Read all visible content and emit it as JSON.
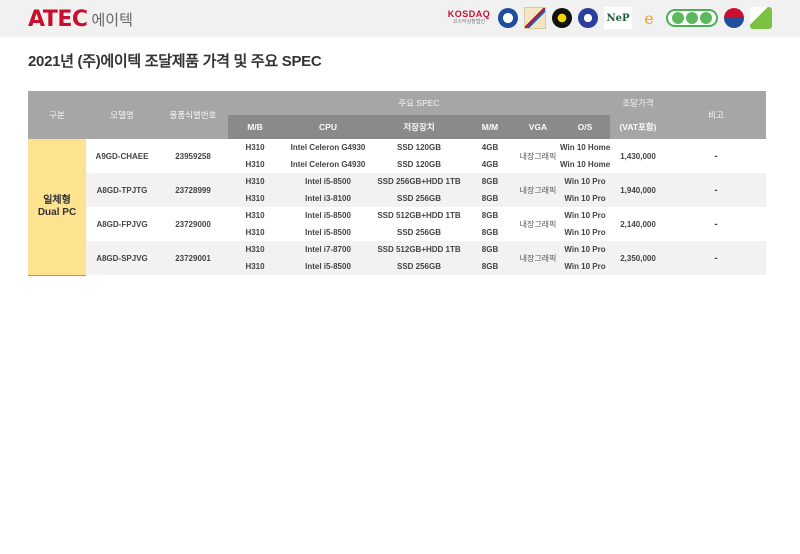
{
  "header": {
    "brand": "ATEC",
    "brand_kr": "에이텍",
    "brand_color": "#c8102e",
    "certifications": [
      {
        "name": "kosdaq-logo",
        "label": "KOSDAQ",
        "sub": "코스닥상장법인"
      },
      {
        "name": "certification-emblem-blue-icon"
      },
      {
        "name": "certification-emblem-flag-icon"
      },
      {
        "name": "good-design-icon",
        "sub": "GOOD DESIGN"
      },
      {
        "name": "e-certification-icon"
      },
      {
        "name": "nep-icon",
        "label": "NeP"
      },
      {
        "name": "e-mark-icon"
      },
      {
        "name": "green-certification-badge-icon"
      },
      {
        "name": "korea-government-icon",
        "sub": "특허청"
      },
      {
        "name": "green-tech-icon",
        "sub": "녹색인증"
      }
    ]
  },
  "page_title": "2021년 (주)에이텍 조달제품 가격 및 주요 SPEC",
  "table": {
    "headers": {
      "category": "구분",
      "model": "모델명",
      "item_id": "물품식별번호",
      "spec_group": "주요 SPEC",
      "mb": "M/B",
      "cpu": "CPU",
      "storage": "저장장치",
      "mm": "M/M",
      "vga": "VGA",
      "os": "O/S",
      "price_line1": "조달가격",
      "price_line2": "(VAT포함)",
      "note": "비고"
    },
    "category_line1": "일체형",
    "category_line2": "Dual PC",
    "category_color": "#fde290",
    "products": [
      {
        "model": "A9GD-CHAEE",
        "item_id": "23959258",
        "vga": "내장그래픽",
        "price": "1,430,000",
        "note": "-",
        "configs": [
          {
            "mb": "H310",
            "cpu": "Intel Celeron G4930",
            "storage": "SSD 120GB",
            "mm": "4GB",
            "os": "Win 10 Home"
          },
          {
            "mb": "H310",
            "cpu": "Intel Celeron G4930",
            "storage": "SSD 120GB",
            "mm": "4GB",
            "os": "Win 10 Home"
          }
        ]
      },
      {
        "model": "A8GD-TPJTG",
        "item_id": "23728999",
        "vga": "내장그래픽",
        "price": "1,940,000",
        "note": "-",
        "configs": [
          {
            "mb": "H310",
            "cpu": "Intel i5-8500",
            "storage": "SSD 256GB+HDD 1TB",
            "mm": "8GB",
            "os": "Win 10 Pro"
          },
          {
            "mb": "H310",
            "cpu": "Intel i3-8100",
            "storage": "SSD 256GB",
            "mm": "8GB",
            "os": "Win 10 Pro"
          }
        ]
      },
      {
        "model": "A8GD-FPJVG",
        "item_id": "23729000",
        "vga": "내장그래픽",
        "price": "2,140,000",
        "note": "-",
        "configs": [
          {
            "mb": "H310",
            "cpu": "Intel i5-8500",
            "storage": "SSD 512GB+HDD 1TB",
            "mm": "8GB",
            "os": "Win 10 Pro"
          },
          {
            "mb": "H310",
            "cpu": "Intel i5-8500",
            "storage": "SSD 256GB",
            "mm": "8GB",
            "os": "Win 10 Pro"
          }
        ]
      },
      {
        "model": "A8GD-SPJVG",
        "item_id": "23729001",
        "vga": "내장그래픽",
        "price": "2,350,000",
        "note": "-",
        "configs": [
          {
            "mb": "H310",
            "cpu": "Intel i7-8700",
            "storage": "SSD 512GB+HDD 1TB",
            "mm": "8GB",
            "os": "Win 10 Pro"
          },
          {
            "mb": "H310",
            "cpu": "Intel i5-8500",
            "storage": "SSD 256GB",
            "mm": "8GB",
            "os": "Win 10 Pro"
          }
        ]
      }
    ]
  }
}
